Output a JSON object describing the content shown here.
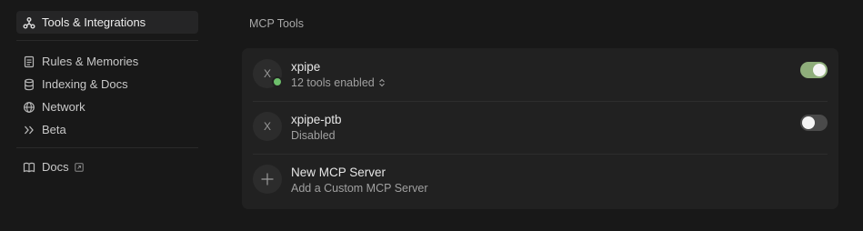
{
  "sidebar": {
    "active_item": {
      "label": "Tools & Integrations",
      "icon": "tools-icon"
    },
    "items": [
      {
        "label": "Rules & Memories",
        "icon": "rules-icon"
      },
      {
        "label": "Indexing & Docs",
        "icon": "database-icon"
      },
      {
        "label": "Network",
        "icon": "globe-icon"
      },
      {
        "label": "Beta",
        "icon": "double-chevron-icon"
      }
    ],
    "docs": {
      "label": "Docs",
      "icon": "book-icon",
      "external_icon": "external-link-icon"
    }
  },
  "main": {
    "section_title": "MCP Tools",
    "servers": [
      {
        "avatar": "X",
        "name": "xpipe",
        "status": "12 tools enabled",
        "enabled": true,
        "online": true
      },
      {
        "avatar": "X",
        "name": "xpipe-ptb",
        "status": "Disabled",
        "enabled": false,
        "online": false
      }
    ],
    "new_server": {
      "title": "New MCP Server",
      "subtitle": "Add a Custom MCP Server",
      "icon": "plus-icon"
    }
  },
  "colors": {
    "background": "#181818",
    "card": "#212121",
    "toggle_on": "#8fae7b",
    "toggle_off": "#4a4a4a",
    "status_online": "#6dbf6b"
  }
}
